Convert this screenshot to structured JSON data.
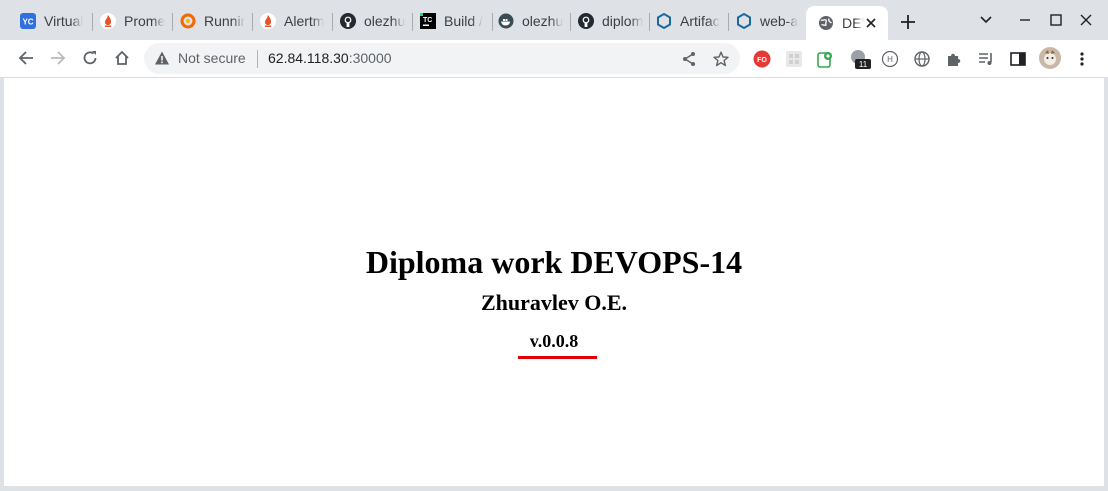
{
  "tabs": [
    {
      "title": "Virtual",
      "icon": "yandex-cloud-icon"
    },
    {
      "title": "Prome",
      "icon": "prometheus-icon"
    },
    {
      "title": "Runnir",
      "icon": "grafana-icon"
    },
    {
      "title": "Alertm",
      "icon": "prometheus-icon"
    },
    {
      "title": "olezhu",
      "icon": "github-icon"
    },
    {
      "title": "Build /",
      "icon": "teamcity-icon"
    },
    {
      "title": "olezhu",
      "icon": "docker-icon"
    },
    {
      "title": "diplom",
      "icon": "github-icon"
    },
    {
      "title": "Artifac",
      "icon": "hexagon-icon"
    },
    {
      "title": "web-a",
      "icon": "hexagon-icon"
    },
    {
      "title": "DEV",
      "icon": "globe-icon",
      "active": true
    }
  ],
  "omnibox": {
    "security_label": "Not secure",
    "host": "62.84.118.30",
    "port": ":30000"
  },
  "page": {
    "title": "Diploma work DEVOPS-14",
    "author": "Zhuravlev O.E.",
    "version": "v.0.0.8"
  },
  "colors": {
    "accent_underline": "#e00000",
    "tabstrip_bg": "#dee1e6",
    "omnibox_bg": "#f1f3f4"
  }
}
